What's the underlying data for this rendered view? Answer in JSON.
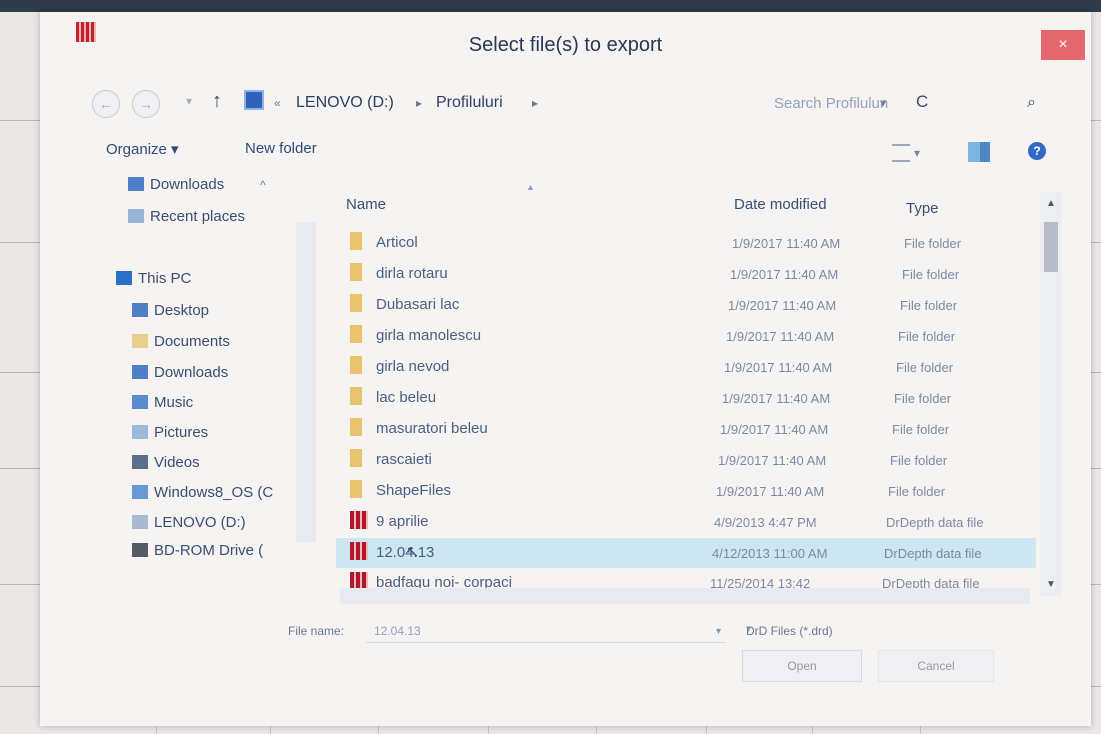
{
  "dialog": {
    "title": "Select file(s) to export",
    "close": "×"
  },
  "nav": {
    "back": "←",
    "forward": "→",
    "recent_dd": "▾",
    "up": "↑",
    "breadcrumbs": [
      "«",
      "LENOVO (D:)",
      "▸",
      "Profiluluri",
      "▸"
    ],
    "address_dropdown": "▾",
    "refresh": "C",
    "search_placeholder": "Search Profilulun",
    "search_icon": "⌕"
  },
  "toolbar": {
    "organize": "Organize ▾",
    "new_folder": "New folder",
    "view_dropdown": "▾",
    "help": "?"
  },
  "navpane": {
    "items": [
      {
        "label": "Downloads",
        "icon": "downloads-icon"
      },
      {
        "label": "Recent places",
        "icon": "recent-places-icon"
      },
      {
        "label": "This PC",
        "icon": "this-pc-icon"
      },
      {
        "label": "Desktop",
        "icon": "desktop-icon"
      },
      {
        "label": "Documents",
        "icon": "documents-icon"
      },
      {
        "label": "Downloads",
        "icon": "downloads-icon"
      },
      {
        "label": "Music",
        "icon": "music-icon"
      },
      {
        "label": "Pictures",
        "icon": "pictures-icon"
      },
      {
        "label": "Videos",
        "icon": "videos-icon"
      },
      {
        "label": "Windows8_OS (C",
        "icon": "drive-icon"
      },
      {
        "label": "LENOVO (D:)",
        "icon": "drive-icon"
      },
      {
        "label": "BD-ROM Drive (",
        "icon": "bd-rom-icon"
      }
    ],
    "chevron": "^"
  },
  "list": {
    "columns": {
      "name": "Name",
      "date": "Date modified",
      "type": "Type"
    },
    "sort_arrow": "▲",
    "files": [
      {
        "name": "Articol",
        "date": "1/9/2017 11:40 AM",
        "type": "File folder",
        "kind": "folder"
      },
      {
        "name": "dirla rotaru",
        "date": "1/9/2017 11:40 AM",
        "type": "File folder",
        "kind": "folder"
      },
      {
        "name": "Dubasari lac",
        "date": "1/9/2017 11:40 AM",
        "type": "File folder",
        "kind": "folder"
      },
      {
        "name": "girla  manolescu",
        "date": "1/9/2017 11:40 AM",
        "type": "File folder",
        "kind": "folder"
      },
      {
        "name": "girla  nevod",
        "date": "1/9/2017 11:40 AM",
        "type": "File folder",
        "kind": "folder"
      },
      {
        "name": "lac beleu",
        "date": "1/9/2017 11:40 AM",
        "type": "File folder",
        "kind": "folder"
      },
      {
        "name": "masuratori beleu",
        "date": "1/9/2017 11:40 AM",
        "type": "File folder",
        "kind": "folder"
      },
      {
        "name": "rascaieti",
        "date": "1/9/2017 11:40 AM",
        "type": "File folder",
        "kind": "folder"
      },
      {
        "name": "ShapeFiles",
        "date": "1/9/2017 11:40 AM",
        "type": "File folder",
        "kind": "folder"
      },
      {
        "name": "9 aprilie",
        "date": "4/9/2013 4:47 PM",
        "type": "DrDepth data file",
        "kind": "data"
      },
      {
        "name": "12.04.13",
        "date": "4/12/2013 11:00 AM",
        "type": "DrDepth data file",
        "kind": "data",
        "selected": true
      },
      {
        "name": "badfagu noi- corpaci",
        "date": "11/25/2014 13:42",
        "type": "DrDepth data file",
        "kind": "data"
      }
    ],
    "scroll_up": "▲",
    "scroll_down": "▼"
  },
  "footer": {
    "file_name_label": "File name:",
    "file_name_value": "12.04.13",
    "file_name_dd": "▾",
    "filter": "DrD Files (*.drd)",
    "filter_dd": "▾",
    "open": "Open",
    "cancel": "Cancel"
  }
}
